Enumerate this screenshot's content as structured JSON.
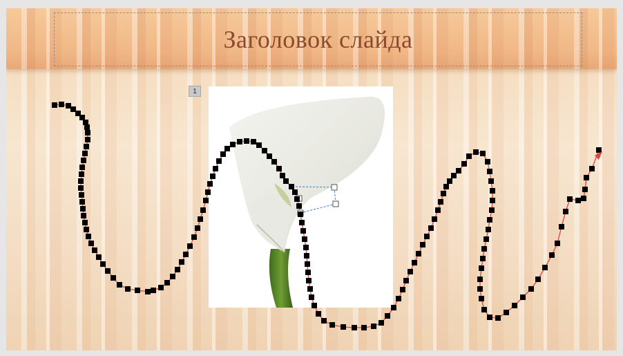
{
  "slide": {
    "title": "Заголовок слайда",
    "animation_tag": "1"
  },
  "colors": {
    "title_text": "#8b4a2b",
    "motion_path": "#e2423a",
    "path_points": "#000000",
    "bezier_handle": "#3f7cc4"
  },
  "image": {
    "subject": "white-calla-lily-photo"
  }
}
